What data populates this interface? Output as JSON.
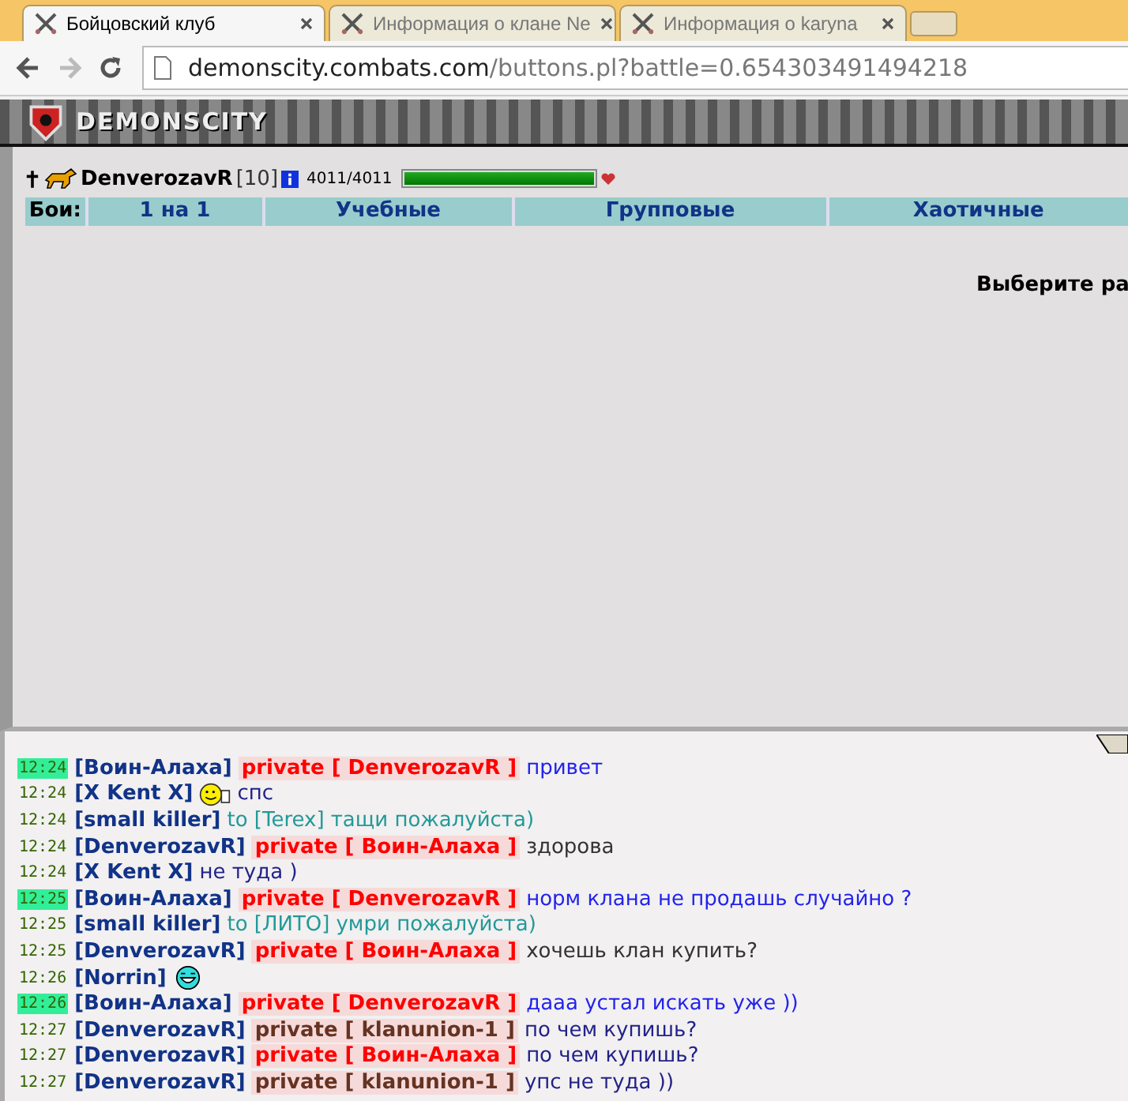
{
  "browser": {
    "tabs": [
      {
        "title": "Бойцовский клуб",
        "selected": true
      },
      {
        "title": "Информация о клане Ne",
        "selected": false
      },
      {
        "title": "Информация о karyna",
        "selected": false
      }
    ],
    "url_host": "demonscity.combats.com",
    "url_path": "/buttons.pl?battle=0.654303491494218"
  },
  "banner": {
    "logo": "DEMONSCITY"
  },
  "player": {
    "name": "DenverozavR",
    "level_text": "[10]",
    "hp": "4011/4011",
    "hp_bar": {
      "level": 1
    }
  },
  "battle_menu": {
    "label": "Бои:",
    "items": [
      {
        "label": "1 на 1"
      },
      {
        "label": "Учебные"
      },
      {
        "label": "Групповые"
      },
      {
        "label": "Хаотичные"
      }
    ]
  },
  "prompt": "Выберите ра",
  "chat": [
    {
      "time": "12:24",
      "highlight": true,
      "nick": "[Воин-Алаха]",
      "kind": "private",
      "tag": {
        "text": "private [ DenverozavR ]",
        "color": "#ff0000"
      },
      "text": "привет",
      "color": "#2222ee"
    },
    {
      "time": "12:24",
      "highlight": false,
      "nick": "[X Kent X]",
      "kind": "smiley",
      "smiley": {
        "kind": "thumb"
      },
      "text": "спс",
      "color": "#222288"
    },
    {
      "time": "12:24",
      "highlight": false,
      "nick": "[small killer]",
      "kind": "to",
      "tag": {
        "text": "to [Terex]",
        "color": "#229999"
      },
      "text": "тащи пожалуйста)",
      "color": "#229999"
    },
    {
      "time": "12:24",
      "highlight": false,
      "nick": "[DenverozavR]",
      "kind": "private",
      "tag": {
        "text": "private [ Воин-Алаха ]",
        "color": "#ff0000"
      },
      "text": "здорова",
      "color": "#333333"
    },
    {
      "time": "12:24",
      "highlight": false,
      "nick": "[X Kent X]",
      "kind": "plain",
      "text": "не туда )",
      "color": "#222288"
    },
    {
      "time": "12:25",
      "highlight": true,
      "nick": "[Воин-Алаха]",
      "kind": "private",
      "tag": {
        "text": "private [ DenverozavR ]",
        "color": "#ff0000"
      },
      "text": "норм клана не продашь случайно ?",
      "color": "#2222ee"
    },
    {
      "time": "12:25",
      "highlight": false,
      "nick": "[small killer]",
      "kind": "to",
      "tag": {
        "text": "to [ЛИТО]",
        "color": "#229999"
      },
      "text": "умри пожалуйста)",
      "color": "#229999"
    },
    {
      "time": "12:25",
      "highlight": false,
      "nick": "[DenverozavR]",
      "kind": "private",
      "tag": {
        "text": "private [ Воин-Алаха ]",
        "color": "#ff0000"
      },
      "text": "хочешь клан купить?",
      "color": "#333333"
    },
    {
      "time": "12:26",
      "highlight": false,
      "nick": "[Norrin]",
      "kind": "smiley",
      "smiley": {
        "kind": "laugh"
      }
    },
    {
      "time": "12:26",
      "highlight": true,
      "nick": "[Воин-Алаха]",
      "kind": "private",
      "tag": {
        "text": "private [ DenverozavR ]",
        "color": "#ff0000"
      },
      "text": "дааа устал искать уже ))",
      "color": "#2222ee"
    },
    {
      "time": "12:27",
      "highlight": false,
      "nick": "[DenverozavR]",
      "kind": "private",
      "tag": {
        "text": "private [ klanunion-1 ]",
        "color": "#663322"
      },
      "text": "по чем купишь?",
      "color": "#222288"
    },
    {
      "time": "12:27",
      "highlight": false,
      "nick": "[DenverozavR]",
      "kind": "private",
      "tag": {
        "text": "private [ Воин-Алаха ]",
        "color": "#ff0000"
      },
      "text": "по чем купишь?",
      "color": "#222288"
    },
    {
      "time": "12:27",
      "highlight": false,
      "nick": "[DenverozavR]",
      "kind": "private",
      "tag": {
        "text": "private [ klanunion-1 ]",
        "color": "#663322"
      },
      "text": "упс не туда ))",
      "color": "#222288"
    }
  ]
}
